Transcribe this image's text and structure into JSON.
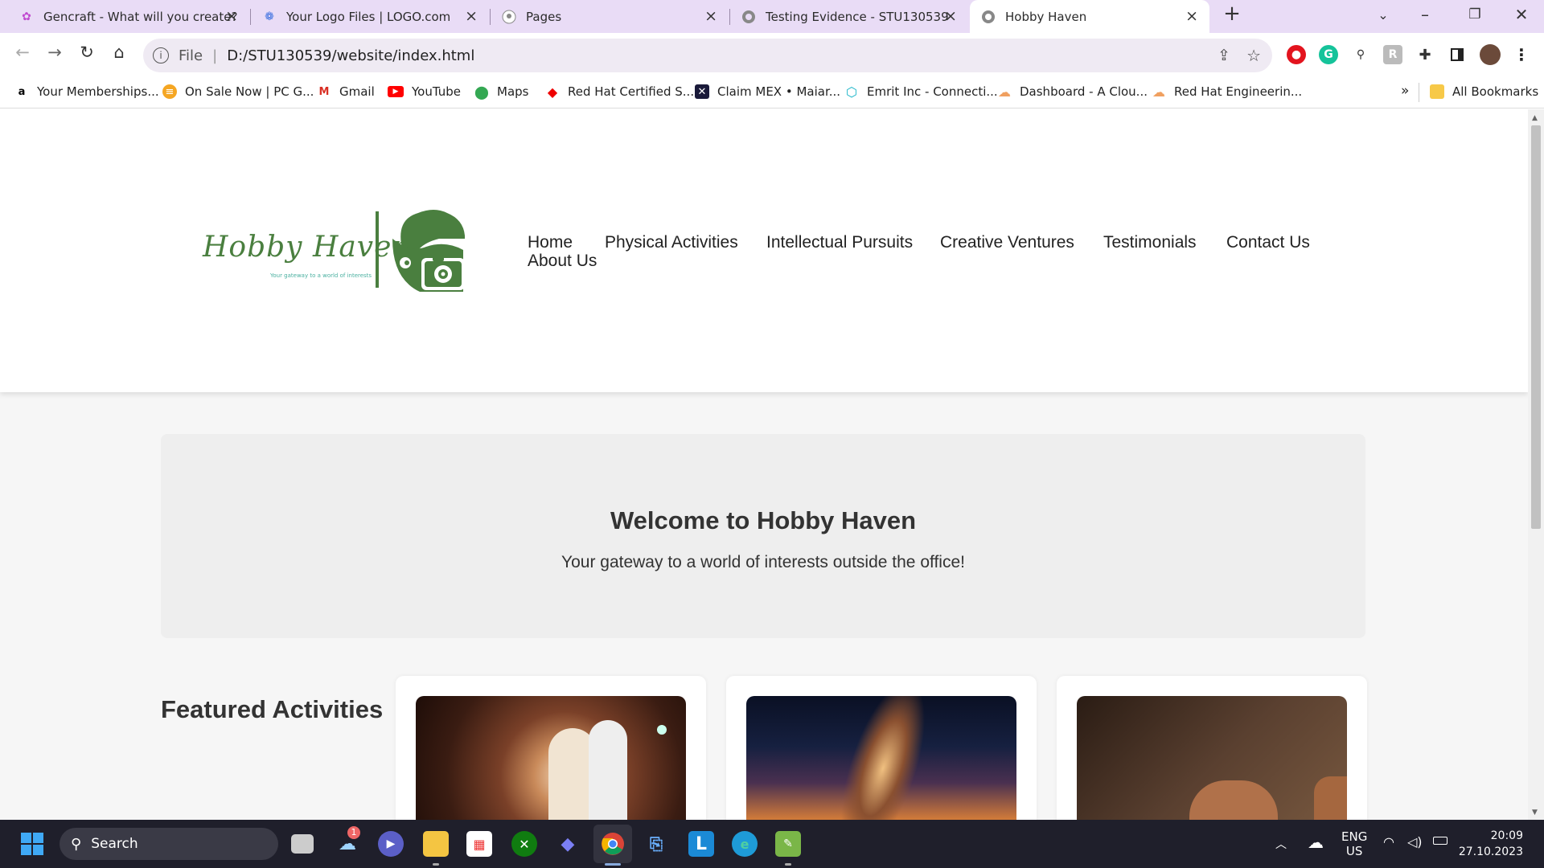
{
  "browser": {
    "tabs": [
      {
        "title": "Gencraft - What will you create?"
      },
      {
        "title": "Your Logo Files | LOGO.com"
      },
      {
        "title": "Pages"
      },
      {
        "title": "Testing Evidence - STU130539"
      },
      {
        "title": "Hobby Haven"
      }
    ],
    "address": {
      "scheme": "File",
      "url": "D:/STU130539/website/index.html"
    },
    "bookmarks": [
      {
        "label": "Your Memberships..."
      },
      {
        "label": "On Sale Now | PC G..."
      },
      {
        "label": "Gmail"
      },
      {
        "label": "YouTube"
      },
      {
        "label": "Maps"
      },
      {
        "label": "Red Hat Certified S..."
      },
      {
        "label": "Claim MEX • Maiar..."
      },
      {
        "label": "Emrit Inc - Connecti..."
      },
      {
        "label": "Dashboard - A Clou..."
      },
      {
        "label": "Red Hat Engineerin..."
      }
    ],
    "more_bookmarks": "»",
    "all_bookmarks": "All Bookmarks"
  },
  "site": {
    "logo": {
      "name": "Hobby Haven",
      "tagline": "Your gateway to a world of interests"
    },
    "nav": [
      "Home",
      "Physical Activities",
      "Intellectual Pursuits",
      "Creative Ventures",
      "Testimonials",
      "Contact Us",
      "About Us"
    ],
    "hero": {
      "title": "Welcome to Hobby Haven",
      "subtitle": "Your gateway to a world of interests outside the office!"
    },
    "featured_title": "Featured Activities",
    "cards": [
      {
        "image": "dance-photo"
      },
      {
        "image": "galaxy-photo"
      },
      {
        "image": "pottery-photo"
      }
    ]
  },
  "taskbar": {
    "search_placeholder": "Search",
    "weather_badge": "1",
    "lang": "ENG",
    "region": "US",
    "time": "20:09",
    "date": "27.10.2023"
  },
  "colors": {
    "brand_green": "#4a7f3f",
    "tab_strip": "#e9dcf6",
    "taskbar": "#1f1f2b"
  }
}
